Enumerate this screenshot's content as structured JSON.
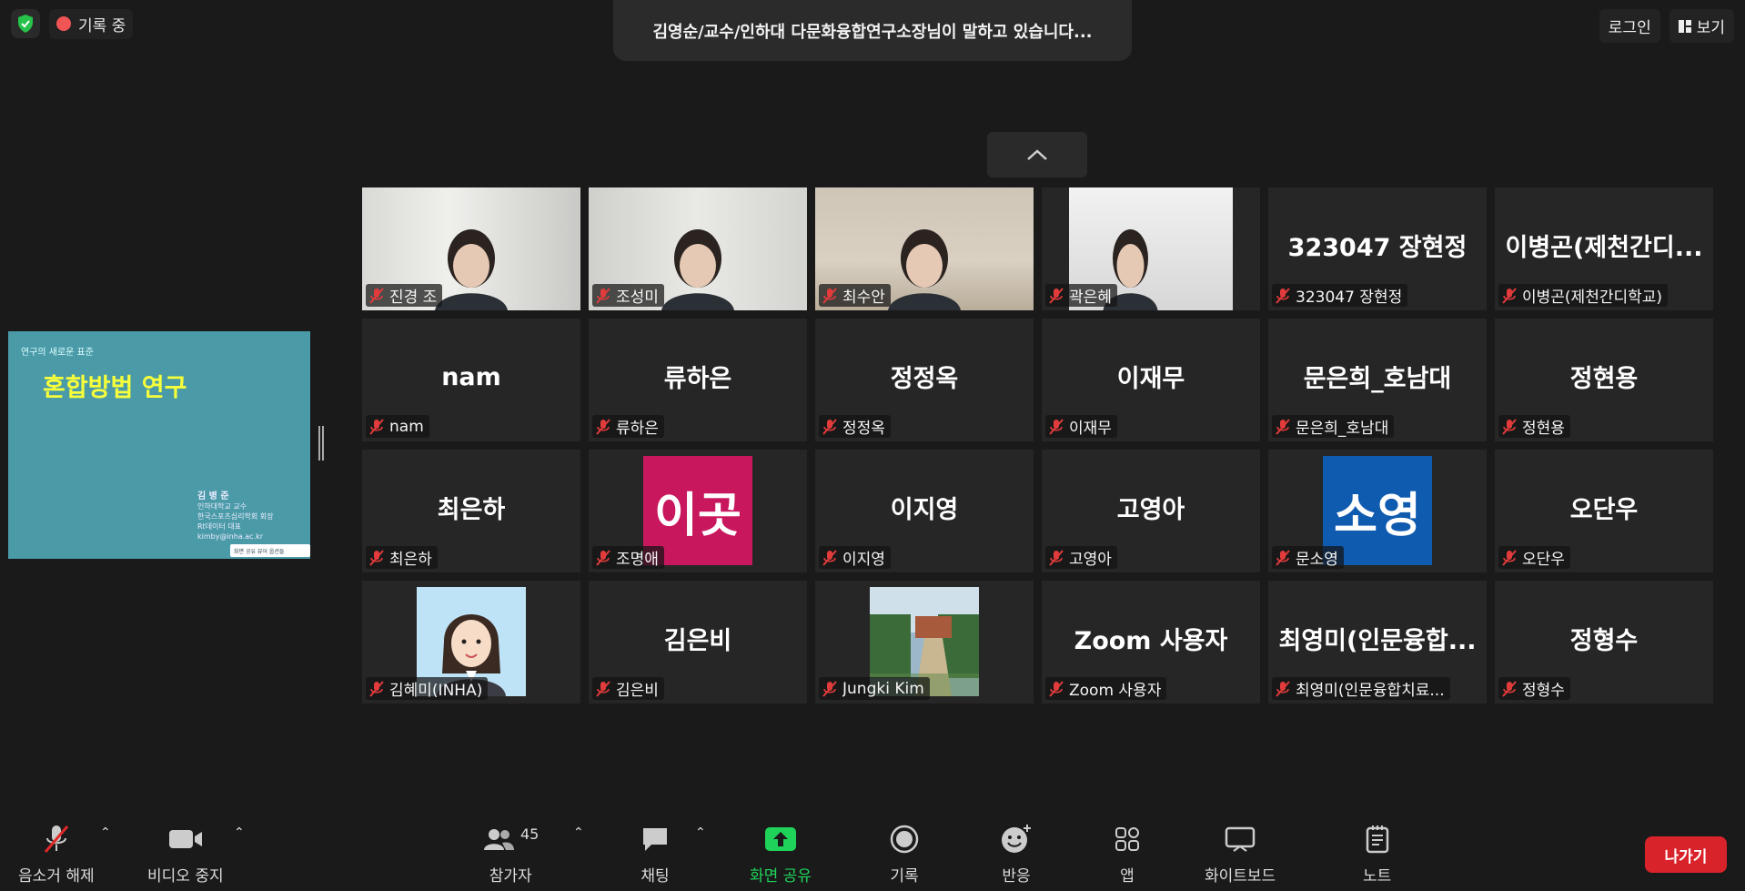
{
  "top": {
    "recording_label": "기록 중",
    "speaking_banner": "김영순/교수/인하대 다문화융합연구소장님이 말하고 있습니다...",
    "login_label": "로그인",
    "view_label": "보기"
  },
  "shared_screen": {
    "subtitle": "연구의 새로운 표준",
    "title": "혼합방법 연구",
    "author_name": "김 병 준",
    "author_line1": "인하대학교 교수",
    "author_line2": "한국스포츠심리학회 회장",
    "author_line3": "Rt데이터 대표",
    "author_email": "kimby@inha.ac.kr",
    "bottom_tag": "화면 공유 뷰어 옵션들"
  },
  "participants": [
    {
      "display": "",
      "name": "진경 조",
      "kind": "video"
    },
    {
      "display": "",
      "name": "조성미",
      "kind": "video"
    },
    {
      "display": "",
      "name": "최수안",
      "kind": "video"
    },
    {
      "display": "",
      "name": "곽은혜",
      "kind": "video"
    },
    {
      "display": "323047 장현정",
      "name": "323047 장현정",
      "kind": "text"
    },
    {
      "display": "이병곤(제천간디...",
      "name": "이병곤(제천간디학교)",
      "kind": "text"
    },
    {
      "display": "nam",
      "name": "nam",
      "kind": "text"
    },
    {
      "display": "류하은",
      "name": "류하은",
      "kind": "text"
    },
    {
      "display": "정정옥",
      "name": "정정옥",
      "kind": "text"
    },
    {
      "display": "이재무",
      "name": "이재무",
      "kind": "text"
    },
    {
      "display": "문은희_호남대",
      "name": "문은희_호남대",
      "kind": "text"
    },
    {
      "display": "정현용",
      "name": "정현용",
      "kind": "text"
    },
    {
      "display": "최은하",
      "name": "최은하",
      "kind": "text"
    },
    {
      "display": "이곳",
      "name": "조명애",
      "kind": "avatar",
      "color": "#c8175d"
    },
    {
      "display": "이지영",
      "name": "이지영",
      "kind": "text"
    },
    {
      "display": "고영아",
      "name": "고영아",
      "kind": "text"
    },
    {
      "display": "소영",
      "name": "문소영",
      "kind": "avatar",
      "color": "#0f5bb0"
    },
    {
      "display": "오단우",
      "name": "오단우",
      "kind": "text"
    },
    {
      "display": "",
      "name": "김혜미(INHA)",
      "kind": "cartoon"
    },
    {
      "display": "김은비",
      "name": "김은비",
      "kind": "text"
    },
    {
      "display": "",
      "name": "Jungki Kim",
      "kind": "landscape"
    },
    {
      "display": "Zoom 사용자",
      "name": "Zoom 사용자",
      "kind": "text"
    },
    {
      "display": "최영미(인문융합...",
      "name": "최영미(인문융합치료...",
      "kind": "text"
    },
    {
      "display": "정형수",
      "name": "정형수",
      "kind": "text"
    }
  ],
  "toolbar": {
    "mute_label": "음소거 해제",
    "video_label": "비디오 중지",
    "participants_label": "참가자",
    "participants_count": "45",
    "chat_label": "채팅",
    "share_label": "화면 공유",
    "record_label": "기록",
    "reactions_label": "반응",
    "apps_label": "앱",
    "whiteboard_label": "화이트보드",
    "notes_label": "노트",
    "leave_label": "나가기"
  }
}
